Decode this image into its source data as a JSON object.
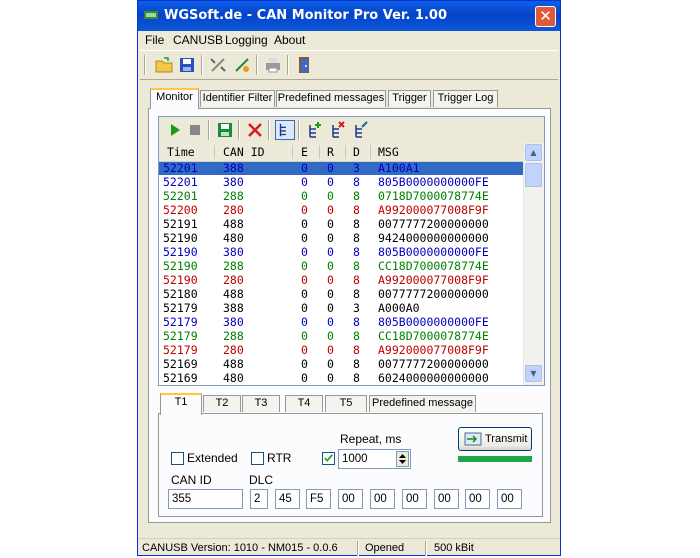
{
  "window": {
    "title": "WGSoft.de - CAN Monitor Pro Ver. 1.00",
    "close_glyph": "✕"
  },
  "menu": [
    "File",
    "CANUSB",
    "Logging",
    "About"
  ],
  "toolbar_icons": [
    "open-folder-icon",
    "save-icon",
    "disconnect-icon",
    "connect-icon",
    "print-icon",
    "exit-door-icon"
  ],
  "tabs": [
    "Monitor",
    "Identifier Filter",
    "Predefined messages",
    "Trigger",
    "Trigger Log"
  ],
  "monitor_toolbar_icons": [
    "play-icon",
    "stop-icon",
    "save-icon",
    "clear-icon",
    "tree-view-icon",
    "tree-add-icon",
    "tree-delete-icon",
    "tree-edit-icon"
  ],
  "columns": [
    "Time",
    "CAN ID",
    "E",
    "R",
    "D",
    "MSG"
  ],
  "rows": [
    {
      "time": "52201",
      "id": "388",
      "e": "0",
      "r": "0",
      "d": "3",
      "msg": "A100A1",
      "color": "#0000c0",
      "selected": true
    },
    {
      "time": "52201",
      "id": "380",
      "e": "0",
      "r": "0",
      "d": "8",
      "msg": "805B0000000000FE",
      "color": "#0000c0"
    },
    {
      "time": "52201",
      "id": "288",
      "e": "0",
      "r": "0",
      "d": "8",
      "msg": "0718D7000078774E",
      "color": "#008000"
    },
    {
      "time": "52200",
      "id": "280",
      "e": "0",
      "r": "0",
      "d": "8",
      "msg": "A992000077008F9F",
      "color": "#c00000"
    },
    {
      "time": "52191",
      "id": "488",
      "e": "0",
      "r": "0",
      "d": "8",
      "msg": "0077777200000000",
      "color": "#000000"
    },
    {
      "time": "52190",
      "id": "480",
      "e": "0",
      "r": "0",
      "d": "8",
      "msg": "9424000000000000",
      "color": "#000000"
    },
    {
      "time": "52190",
      "id": "380",
      "e": "0",
      "r": "0",
      "d": "8",
      "msg": "805B0000000000FE",
      "color": "#0000c0"
    },
    {
      "time": "52190",
      "id": "288",
      "e": "0",
      "r": "0",
      "d": "8",
      "msg": "CC18D7000078774E",
      "color": "#008000"
    },
    {
      "time": "52190",
      "id": "280",
      "e": "0",
      "r": "0",
      "d": "8",
      "msg": "A992000077008F9F",
      "color": "#c00000"
    },
    {
      "time": "52180",
      "id": "488",
      "e": "0",
      "r": "0",
      "d": "8",
      "msg": "0077777200000000",
      "color": "#000000"
    },
    {
      "time": "52179",
      "id": "388",
      "e": "0",
      "r": "0",
      "d": "3",
      "msg": "A000A0",
      "color": "#000000"
    },
    {
      "time": "52179",
      "id": "380",
      "e": "0",
      "r": "0",
      "d": "8",
      "msg": "805B0000000000FE",
      "color": "#0000c0"
    },
    {
      "time": "52179",
      "id": "288",
      "e": "0",
      "r": "0",
      "d": "8",
      "msg": "CC18D7000078774E",
      "color": "#008000"
    },
    {
      "time": "52179",
      "id": "280",
      "e": "0",
      "r": "0",
      "d": "8",
      "msg": "A992000077008F9F",
      "color": "#c00000"
    },
    {
      "time": "52169",
      "id": "488",
      "e": "0",
      "r": "0",
      "d": "8",
      "msg": "0077777200000000",
      "color": "#000000"
    },
    {
      "time": "52169",
      "id": "480",
      "e": "0",
      "r": "0",
      "d": "8",
      "msg": "6024000000000000",
      "color": "#000000"
    }
  ],
  "transmit_tabs": [
    "T1",
    "T2",
    "T3",
    "T4",
    "T5",
    "Predefined message"
  ],
  "transmit": {
    "extended_label": "Extended",
    "extended_checked": false,
    "rtr_label": "RTR",
    "rtr_checked": false,
    "repeat_label": "Repeat, ms",
    "repeat_checked": true,
    "repeat_value": "1000",
    "transmit_label": "Transmit",
    "can_id_label": "CAN ID",
    "can_id_value": "355",
    "dlc_label": "DLC",
    "dlc_value": "2",
    "data_bytes": [
      "45",
      "F5",
      "00",
      "00",
      "00",
      "00",
      "00",
      "00"
    ]
  },
  "status": {
    "version": "CANUSB Version: 1010 - NM015 - 0.0.6",
    "state": "Opened",
    "bitrate": "500 kBit"
  }
}
